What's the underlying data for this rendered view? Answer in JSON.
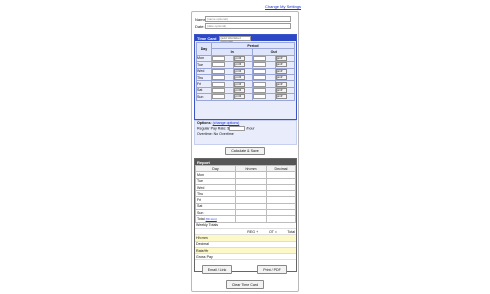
{
  "top_link": "Change My Settings",
  "name": {
    "label": "Name:",
    "placeholder": "(name optional)"
  },
  "date": {
    "label": "Date:",
    "placeholder": "(date optional)"
  },
  "time_card": {
    "title": "Time Card",
    "subtitle_placeholder": "(add title/label optional)",
    "col_day": "Day",
    "col_period": "Period",
    "col_in": "In",
    "col_out": "Out",
    "ampm": "pm",
    "days": [
      "Mon",
      "Tue",
      "Wed",
      "Thu",
      "Fri",
      "Sat",
      "Sun"
    ]
  },
  "options": {
    "label": "Options",
    "change_link": "(change options)",
    "regular_pay_label": "Regular Pay Rate: $",
    "regular_pay_suffix": "/hour",
    "overtime": "Overtime: No Overtime"
  },
  "calculate_button": "Calculate & Save",
  "report": {
    "title": "Report",
    "col_day": "Day",
    "col_hhmm": "hh:mm",
    "col_decimal": "Decimal",
    "days": [
      "Mon",
      "Tue",
      "Wed",
      "Thu",
      "Fri",
      "Sat",
      "Sun"
    ],
    "total_label": "Total",
    "total_note": "(hh:mm)",
    "weekly_totals": "Weekly Totals",
    "reg": "REG",
    "ot": "OT",
    "total": "Total",
    "plus": "+",
    "equals": "=",
    "rows": [
      "Hh:mm",
      "Decimal",
      "Rate/Hr",
      "Gross Pay"
    ]
  },
  "email_button": "Email / Link",
  "print_button": "Print / PDF",
  "clear_button": "Clear Time Card"
}
